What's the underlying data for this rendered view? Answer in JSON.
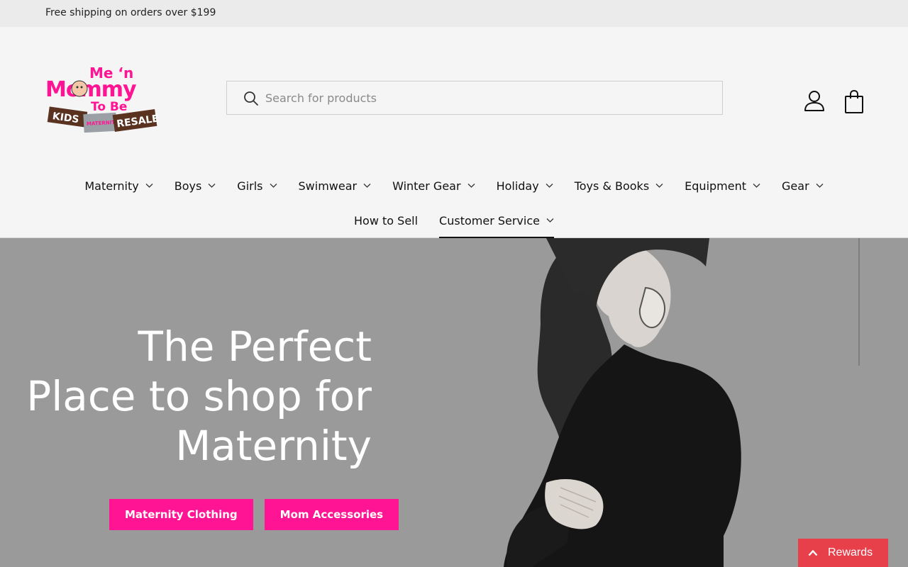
{
  "announcement": "Free shipping on orders over $199",
  "brand": {
    "logo_line1": "Me ‘n",
    "logo_line2": "Mommy",
    "logo_line3": "To Be",
    "logo_kids": "KIDS",
    "logo_maternity": "MATERNITY",
    "logo_resale": "RESALE",
    "pink": "#ff1493"
  },
  "search": {
    "placeholder": "Search for products"
  },
  "nav": {
    "row1": [
      {
        "label": "Maternity"
      },
      {
        "label": "Boys"
      },
      {
        "label": "Girls"
      },
      {
        "label": "Swimwear"
      },
      {
        "label": "Winter Gear"
      },
      {
        "label": "Holiday"
      },
      {
        "label": "Toys & Books"
      },
      {
        "label": "Equipment"
      },
      {
        "label": "Gear"
      }
    ],
    "row2": [
      {
        "label": "How to Sell"
      },
      {
        "label": "Customer Service"
      }
    ]
  },
  "hero": {
    "title_line1": "The Perfect",
    "title_line2": "Place to shop for",
    "title_line3": "Maternity",
    "button1": "Maternity Clothing",
    "button2": "Mom Accessories"
  },
  "rewards": {
    "label": "Rewards",
    "color": "#e8404b"
  },
  "icons": [
    "search-icon",
    "account-icon",
    "bag-icon",
    "chevron-down-icon",
    "caret-up-icon"
  ]
}
